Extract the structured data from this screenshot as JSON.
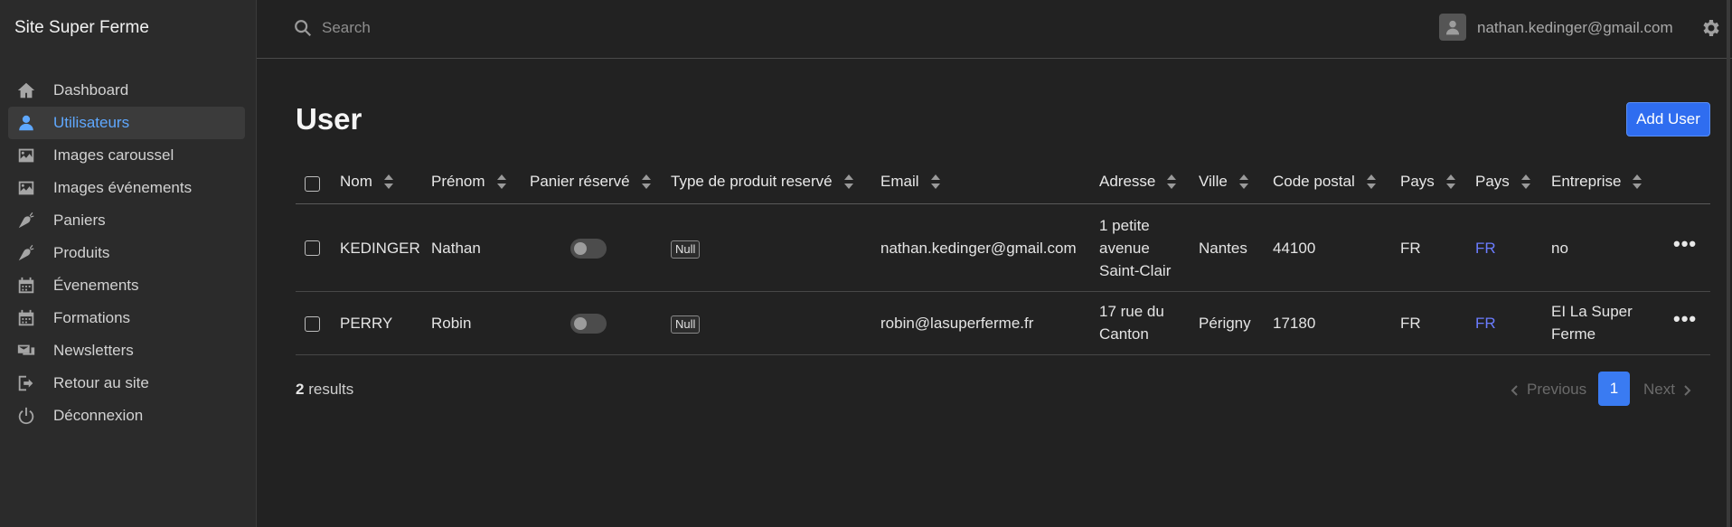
{
  "app": {
    "title": "Site Super Ferme"
  },
  "sidebar": {
    "items": [
      {
        "label": "Dashboard",
        "icon": "home-icon",
        "active": false
      },
      {
        "label": "Utilisateurs",
        "icon": "user-icon",
        "active": true
      },
      {
        "label": "Images caroussel",
        "icon": "image-icon",
        "active": false
      },
      {
        "label": "Images événements",
        "icon": "image-icon",
        "active": false
      },
      {
        "label": "Paniers",
        "icon": "carrot-icon",
        "active": false
      },
      {
        "label": "Produits",
        "icon": "carrot-icon",
        "active": false
      },
      {
        "label": "Évenements",
        "icon": "calendar-icon",
        "active": false
      },
      {
        "label": "Formations",
        "icon": "calendar-icon",
        "active": false
      },
      {
        "label": "Newsletters",
        "icon": "newsletter-icon",
        "active": false
      },
      {
        "label": "Retour au site",
        "icon": "exit-icon",
        "active": false
      },
      {
        "label": "Déconnexion",
        "icon": "power-icon",
        "active": false
      }
    ]
  },
  "topbar": {
    "search_placeholder": "Search",
    "user_email": "nathan.kedinger@gmail.com"
  },
  "page": {
    "title": "User",
    "add_button": "Add User"
  },
  "table": {
    "columns": [
      "Nom",
      "Prénom",
      "Panier réservé",
      "Type de produit reservé",
      "Email",
      "Adresse",
      "Ville",
      "Code postal",
      "Pays",
      "Pays",
      "Entreprise"
    ],
    "rows": [
      {
        "nom": "KEDINGER",
        "prenom": "Nathan",
        "panier_reserve": false,
        "type_produit": "Null",
        "email": "nathan.kedinger@gmail.com",
        "adresse_lines": [
          "1 petite",
          "avenue",
          "Saint-Clair"
        ],
        "ville": "Nantes",
        "code_postal": "44100",
        "pays": "FR",
        "pays_link": "FR",
        "entreprise": "no",
        "actions": "•••"
      },
      {
        "nom": "PERRY",
        "prenom": "Robin",
        "panier_reserve": false,
        "type_produit": "Null",
        "email": "robin@lasuperferme.fr",
        "adresse_lines": [
          "17 rue du",
          "Canton"
        ],
        "ville": "Périgny",
        "code_postal": "17180",
        "pays": "FR",
        "pays_link": "FR",
        "entreprise": "EI La Super Ferme",
        "actions": "•••"
      }
    ]
  },
  "footer": {
    "results_count": "2",
    "results_label": "results",
    "previous": "Previous",
    "current_page": "1",
    "next": "Next"
  },
  "colors": {
    "accent": "#2f6df0",
    "active_nav": "#5fa8ff",
    "link": "#6b7cff",
    "background": "#222222",
    "sidebar": "#2b2b2b"
  }
}
